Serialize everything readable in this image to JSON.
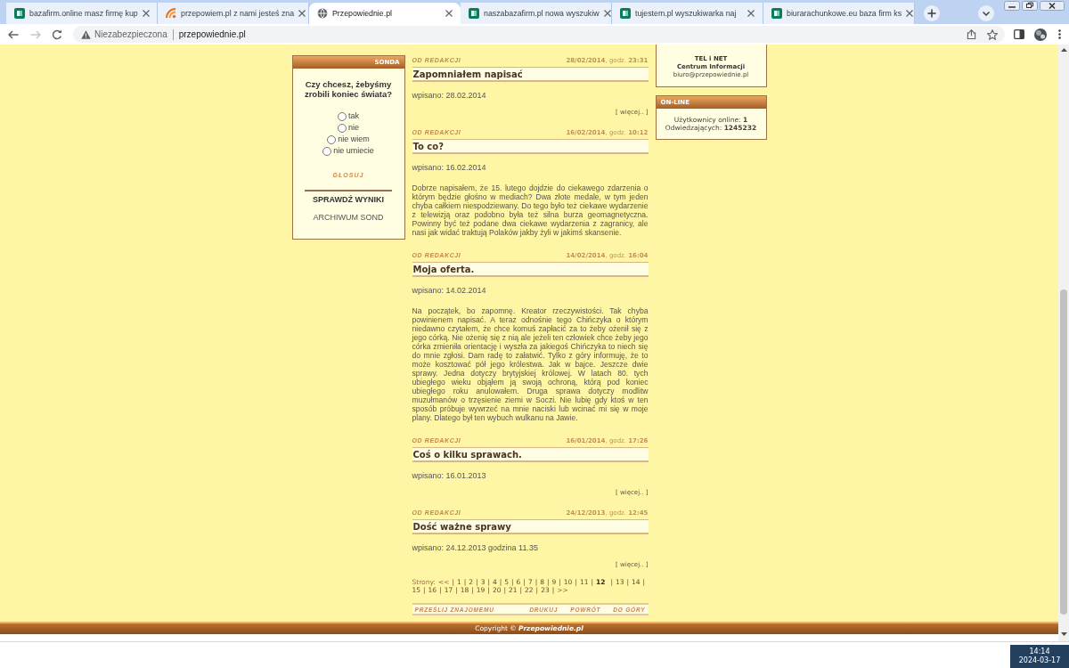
{
  "browser": {
    "tabs": [
      {
        "title": "bazafirm.online masz firmę kup",
        "kind": "square",
        "selected": false
      },
      {
        "title": "przepowiem.pl z nami jesteś zna",
        "kind": "arcs",
        "selected": false
      },
      {
        "title": "Przepowiednie.pl",
        "kind": "globe",
        "selected": true
      },
      {
        "title": "naszabazafirm.pl nowa wyszukiw",
        "kind": "square",
        "selected": false
      },
      {
        "title": "tujestem.pl wyszukiwarka naj",
        "kind": "square",
        "selected": false
      },
      {
        "title": "biurarachunkowe.eu baza firm ks",
        "kind": "square",
        "selected": false
      }
    ],
    "address": {
      "security_label": "Niezabezpieczona",
      "url": "przepowiednie.pl"
    }
  },
  "left_sidebar": {
    "poll": {
      "header": "SONDA",
      "question": "Czy chcesz, żebyśmy zrobili koniec świata?",
      "options": [
        {
          "label": "tak",
          "selected": false
        },
        {
          "label": "nie",
          "selected": false
        },
        {
          "label": "nie wiem",
          "selected": false
        },
        {
          "label": "nie umiecie",
          "selected": false
        }
      ],
      "vote_button": "GŁOSUJ",
      "results_link": "SPRAWDŹ WYNIKI",
      "archive_link": "ARCHIWUM SOND"
    }
  },
  "posts": [
    {
      "category": "OD REDAKCJI",
      "date": "**28/02/2014**, godz. **23:31**",
      "title": "Zapomniałem napisać",
      "entered": "wpisano: 28.02.2014",
      "more_link": "[ więcej.. ]"
    },
    {
      "category": "OD REDAKCJI",
      "date": "**16/02/2014**, godz. **10:12**",
      "title": "To co?",
      "entered": "wpisano: 16.02.2014",
      "body": "Dobrze napisałem, że 15. lutego dojdzie do ciekawego zdarzenia o którym będzie głośno w mediach? Dwa złote medale, w tym jeden chyba całkiem niespodziewany. Do tego było też ciekawe wydarzenie z telewizją oraz podobno była też silna burza geomagnetyczna. Powinny być też podane dwa ciekawe wydarzenia z zagranicy, ale nasi jak widać traktują Polaków jakby żyli w jakimś skansenie."
    },
    {
      "category": "OD REDAKCJI",
      "date": "**14/02/2014**, godz. **16:04**",
      "title": "Moja oferta.",
      "entered": "wpisano: 14.02.2014",
      "body": "Na początek, bo zapomnę. Kreator rzeczywistości. Tak chyba powinienem napisać. A teraz odnośnie tego Chińczyka o którym niedawno czytałem, że chce komuś zapłacić za to żeby ożenił się z jego córką. Nie ożenię się z nią ale jeżeli ten człowiek chce żeby jego córka zmieniła orientację i wyszła za jakiegoś Chińczyka to niech się do mnie zgłosi. Dam radę to załatwić. Tylko z góry informuję, że to może kosztować pół jego królestwa. Jak w bajce. Jeszcze dwie sprawy. Jedna dotyczy brytyjskiej królowej. W latach 80. tych ubiegłego wieku objąłem ją swoją ochroną, którą pod koniec ubiegłego roku anulowałem. Druga sprawa dotyczy modlitw muzułmanów o trzęsienie ziemi w Soczi. Nie lubię gdy ktoś w ten sposób próbuje wywrzeć na mnie naciski lub wcinać mi się w moje plany. Dlatego był ten wybuch wulkanu na Jawie."
    },
    {
      "category": "OD REDAKCJI",
      "date": "**16/01/2014**, godz. **17:26**",
      "title": "Coś o kilku sprawach.",
      "entered": "wpisano: 16.01.2013",
      "more_link": "[ więcej.. ]"
    },
    {
      "category": "OD REDAKCJI",
      "date": "**24/12/2013**, godz. **12:45**",
      "title": "Dość ważne sprawy",
      "entered": "wpisano: 24.12.2013 godzina 11.35",
      "more_link": "[ więcej.. ]"
    }
  ],
  "pagination": {
    "label": "Strony:",
    "prev": "<<",
    "separator": "|",
    "pages": [
      {
        "label": "1",
        "selected": false
      },
      {
        "label": "2",
        "selected": false
      },
      {
        "label": "3",
        "selected": false
      },
      {
        "label": "4",
        "selected": false
      },
      {
        "label": "5",
        "selected": false
      },
      {
        "label": "6",
        "selected": false
      },
      {
        "label": "7",
        "selected": false
      },
      {
        "label": "8",
        "selected": false
      },
      {
        "label": "9",
        "selected": false
      },
      {
        "label": "10",
        "selected": false
      },
      {
        "label": "11",
        "selected": false
      },
      {
        "label": "12",
        "selected": true
      },
      {
        "label": "13",
        "selected": false
      },
      {
        "label": "14",
        "selected": false
      },
      {
        "label": "15",
        "selected": false
      },
      {
        "label": "16",
        "selected": false
      },
      {
        "label": "17",
        "selected": false
      },
      {
        "label": "18",
        "selected": false
      },
      {
        "label": "19",
        "selected": false
      },
      {
        "label": "20",
        "selected": false
      },
      {
        "label": "21",
        "selected": false
      },
      {
        "label": "22",
        "selected": false
      },
      {
        "label": "23",
        "selected": false
      }
    ],
    "next": ">>"
  },
  "bottom_links": {
    "left": [
      "PRZEŚLIJ ZNAJOMEMU"
    ],
    "right": [
      "DRUKUJ",
      "POWRÓT",
      "DO GÓRY"
    ]
  },
  "right_sidebar": {
    "contact": {
      "lines": [
        "TEL i NET",
        "Centrum Informacji"
      ],
      "email": "biuro@przepowiednie.pl"
    },
    "online": {
      "header": "ON-LINE",
      "stats": [
        "Użytkownicy online: **1**",
        "Odwiedzających: **1245232**"
      ]
    }
  },
  "footer": {
    "copyright": "Copyright © **Przepowiednie.pl**"
  },
  "taskbar": {
    "time": "14:14",
    "date": "2024-03-17"
  }
}
